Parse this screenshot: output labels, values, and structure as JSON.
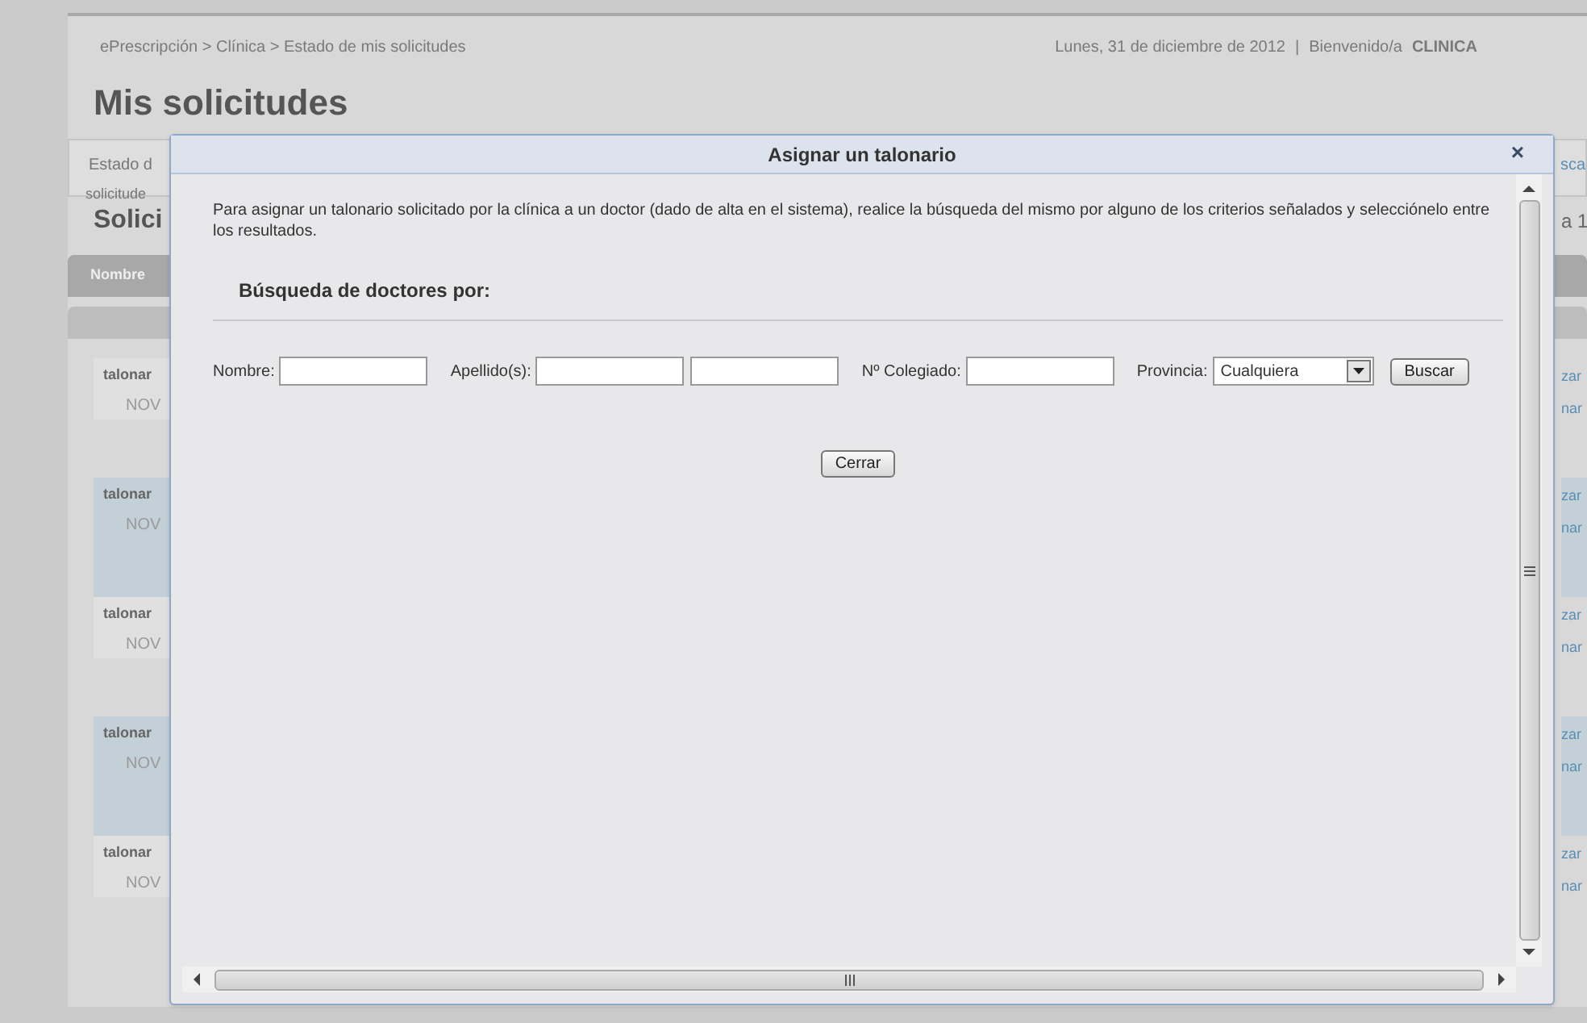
{
  "breadcrumb": "ePrescripción > Clínica > Estado de mis solicitudes",
  "date": "Lunes, 31 de diciembre de 2012",
  "date_separator": "|",
  "welcome": "Bienvenido/a",
  "user": "CLINICA",
  "page_title": "Mis solicitudes",
  "background": {
    "tab": "Estado d",
    "tab_right": "sca",
    "tab_sub": "solicitude",
    "section_title": "Solici",
    "section_right": "a 1",
    "header_column": "Nombre",
    "rows": [
      {
        "column_1": "talonar",
        "column_2": "NOV",
        "right_1": "zar",
        "right_2": "nar",
        "highlighted": false
      },
      {
        "column_1": "talonar",
        "column_2": "NOV",
        "right_1": "zar",
        "right_2": "nar",
        "highlighted": true
      },
      {
        "column_1": "talonar",
        "column_2": "NOV",
        "right_1": "zar",
        "right_2": "nar",
        "highlighted": false
      },
      {
        "column_1": "talonar",
        "column_2": "NOV",
        "right_1": "zar",
        "right_2": "nar",
        "highlighted": true
      },
      {
        "column_1": "talonar",
        "column_2": "NOV",
        "right_1": "zar",
        "right_2": "nar",
        "highlighted": false
      }
    ]
  },
  "dialog": {
    "title": "Asignar un talonario",
    "close": "×",
    "intro": "Para asignar un talonario solicitado por la clínica a un doctor (dado de alta en el sistema), realice la búsqueda del mismo por alguno de los criterios señalados y selecciónelo entre los resultados.",
    "section_title": "Búsqueda de doctores por:",
    "fields": [
      {
        "kind": "text",
        "label": "Nombre:"
      },
      {
        "kind": "pair",
        "label": "Apellido(s):"
      },
      {
        "kind": "text",
        "label": "Nº Colegiado:"
      },
      {
        "kind": "select",
        "label": "Provincia:",
        "value": "Cualquiera"
      }
    ],
    "search_button": "Buscar",
    "close_button": "Cerrar"
  }
}
